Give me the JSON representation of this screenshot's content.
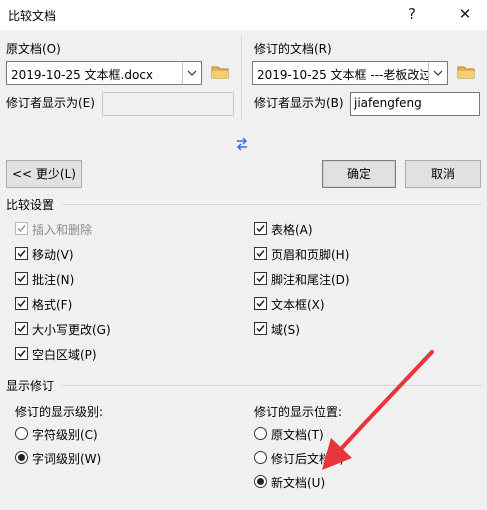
{
  "window": {
    "title": "比较文档",
    "help_glyph": "?",
    "close_glyph": "✕"
  },
  "original": {
    "label": "原文档(O)",
    "value": "2019-10-25 文本框.docx",
    "label_as": "修订者显示为(E)",
    "label_as_value": ""
  },
  "revised": {
    "label": "修订的文档(R)",
    "value": "2019-10-25 文本框 ---老板改过",
    "label_as": "修订者显示为(B)",
    "label_as_value": "jiafengfeng"
  },
  "buttons": {
    "less": "<< 更少(L)",
    "ok": "确定",
    "cancel": "取消"
  },
  "compare_settings": {
    "title": "比较设置",
    "left": [
      {
        "label": "插入和删除",
        "checked": true,
        "disabled": true
      },
      {
        "label": "移动(V)",
        "checked": true,
        "disabled": false
      },
      {
        "label": "批注(N)",
        "checked": true,
        "disabled": false
      },
      {
        "label": "格式(F)",
        "checked": true,
        "disabled": false
      },
      {
        "label": "大小写更改(G)",
        "checked": true,
        "disabled": false
      },
      {
        "label": "空白区域(P)",
        "checked": true,
        "disabled": false
      }
    ],
    "right": [
      {
        "label": "表格(A)",
        "checked": true
      },
      {
        "label": "页眉和页脚(H)",
        "checked": true
      },
      {
        "label": "脚注和尾注(D)",
        "checked": true
      },
      {
        "label": "文本框(X)",
        "checked": true
      },
      {
        "label": "域(S)",
        "checked": true
      }
    ]
  },
  "show_changes": {
    "title": "显示修订",
    "level_title": "修订的显示级别:",
    "levels": [
      {
        "label": "字符级别(C)",
        "selected": false
      },
      {
        "label": "字词级别(W)",
        "selected": true
      }
    ],
    "location_title": "修订的显示位置:",
    "locations": [
      {
        "label": "原文档(T)",
        "selected": false
      },
      {
        "label": "修订后文档(I)",
        "selected": false
      },
      {
        "label": "新文档(U)",
        "selected": true
      }
    ]
  },
  "colors": {
    "accent_arrow": "#e8343a"
  }
}
